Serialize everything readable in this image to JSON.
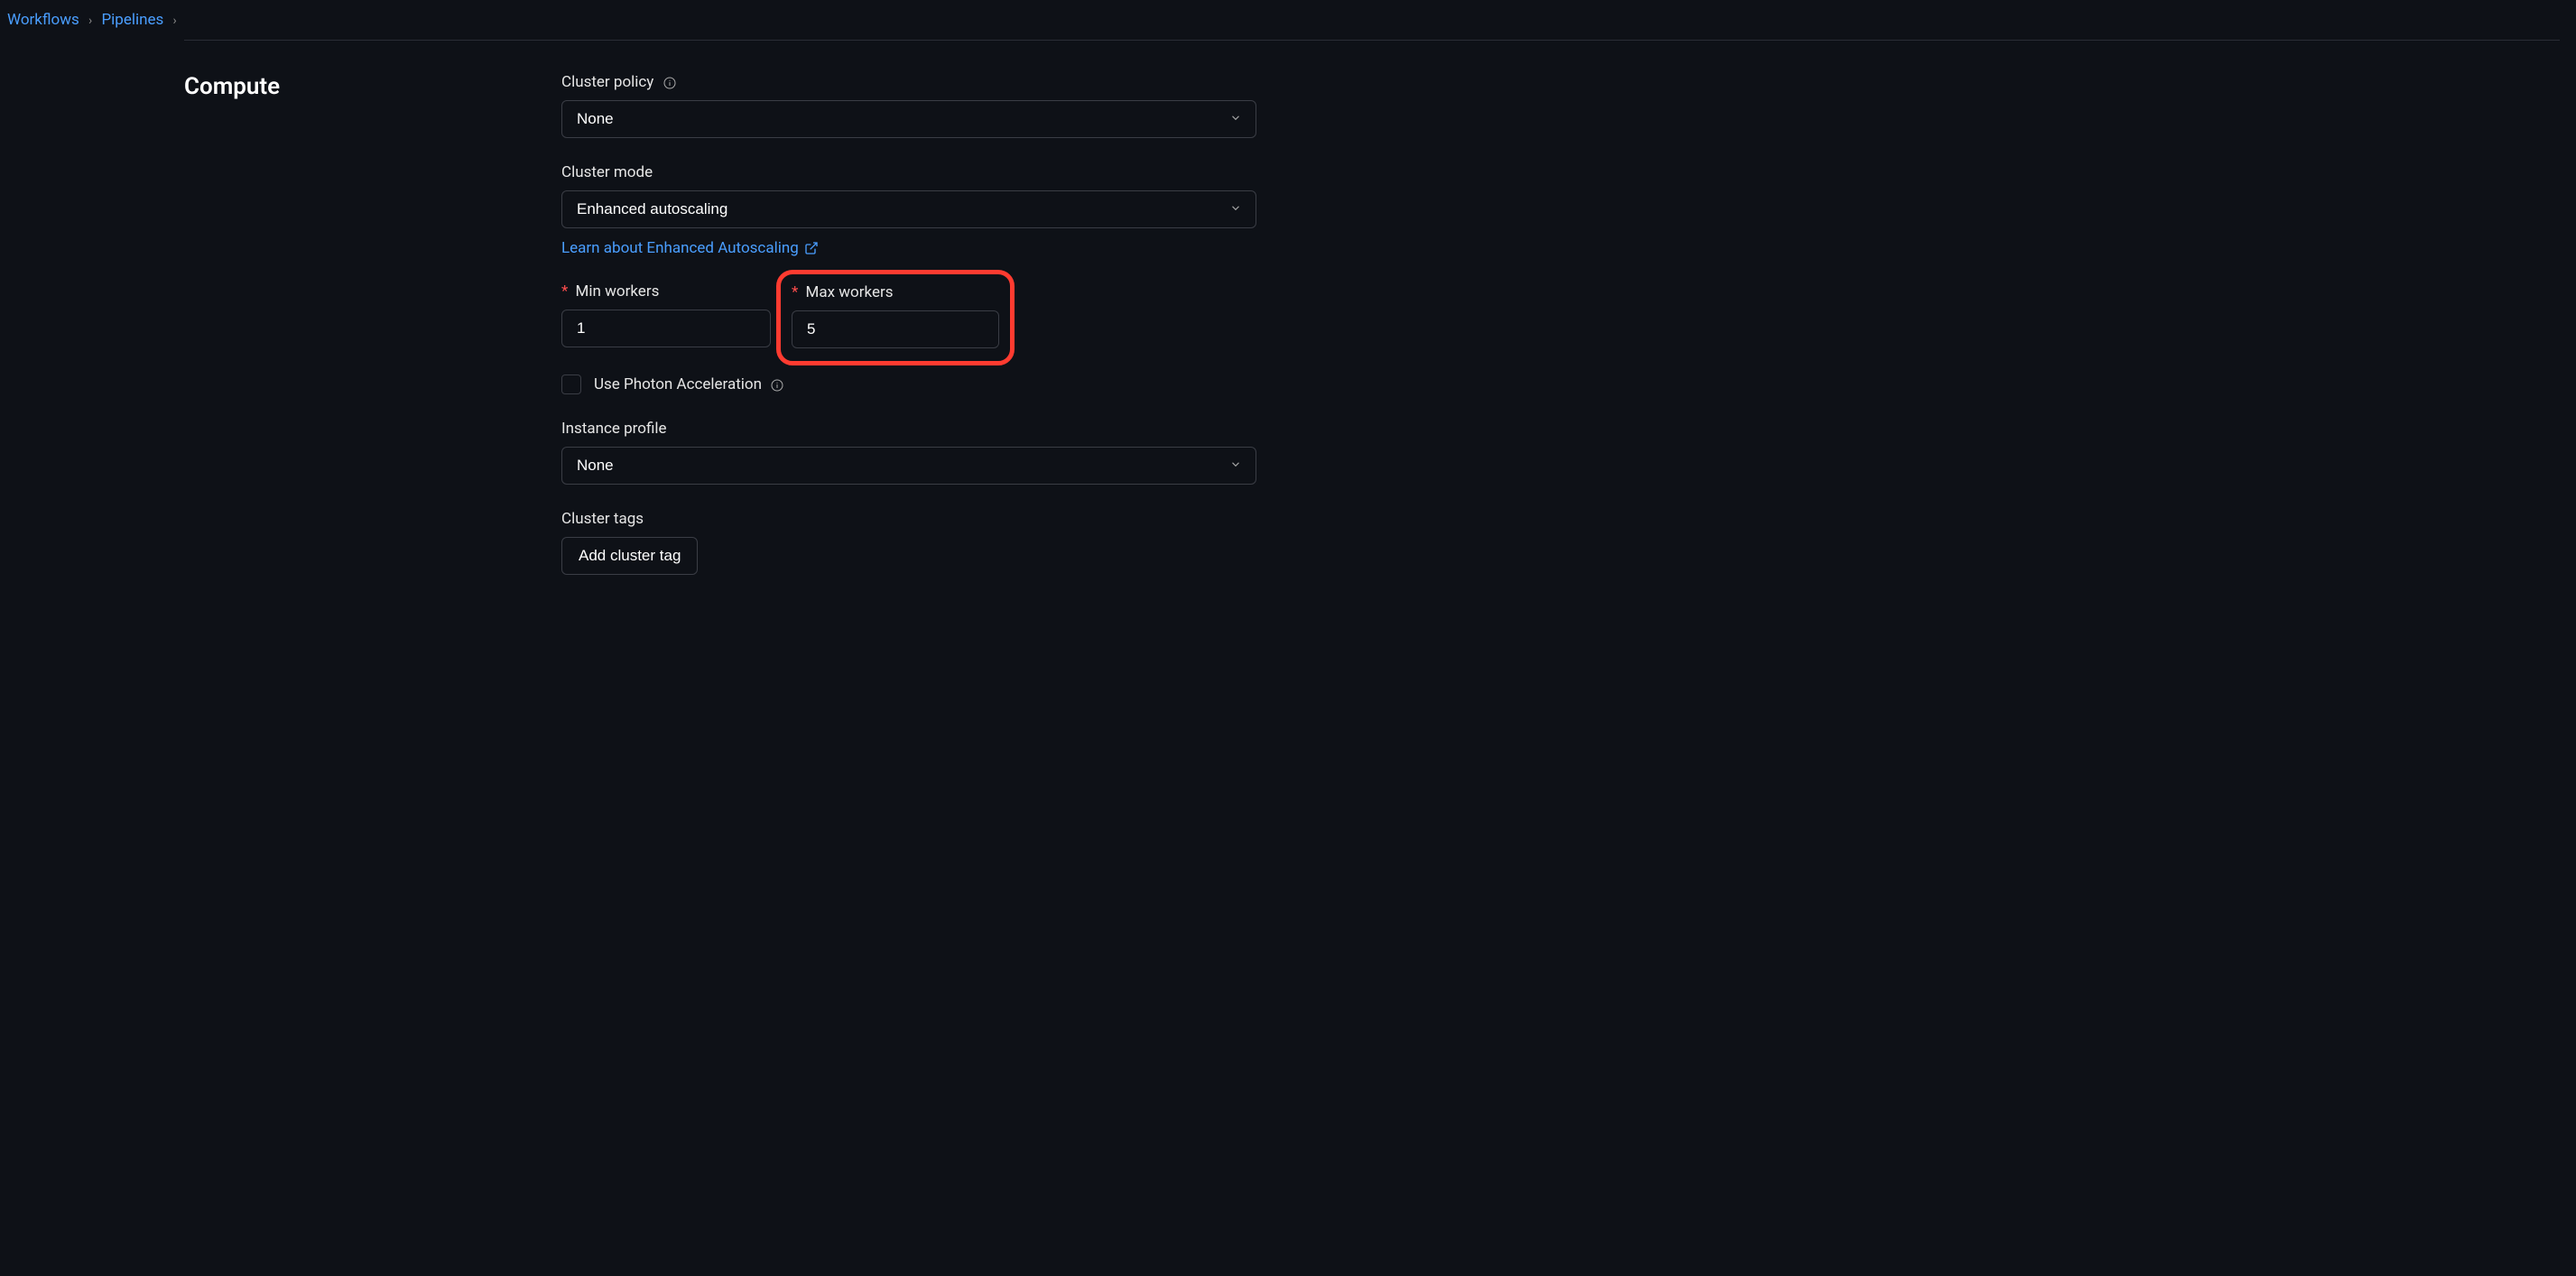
{
  "breadcrumb": {
    "item1": "Workflows",
    "item2": "Pipelines"
  },
  "section_title": "Compute",
  "cluster_policy": {
    "label": "Cluster policy",
    "value": "None"
  },
  "cluster_mode": {
    "label": "Cluster mode",
    "value": "Enhanced autoscaling",
    "help_link": "Learn about Enhanced Autoscaling"
  },
  "min_workers": {
    "label": "Min workers",
    "value": "1"
  },
  "max_workers": {
    "label": "Max workers",
    "value": "5"
  },
  "photon": {
    "label": "Use Photon Acceleration"
  },
  "instance_profile": {
    "label": "Instance profile",
    "value": "None"
  },
  "cluster_tags": {
    "label": "Cluster tags",
    "button": "Add cluster tag"
  }
}
